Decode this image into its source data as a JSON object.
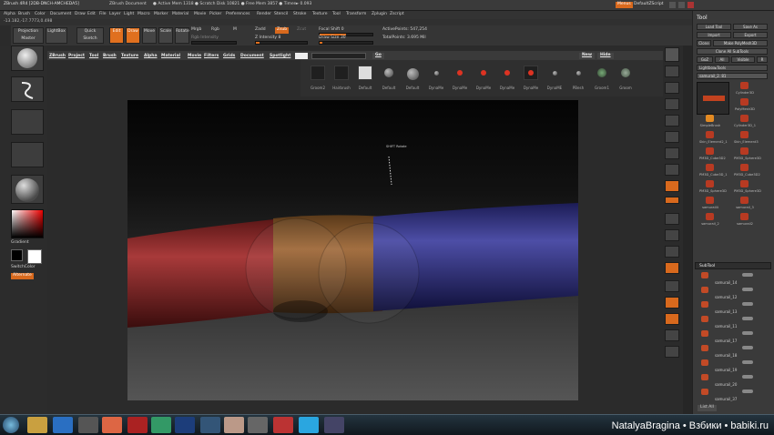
{
  "titlebar": {
    "title": "ZBrush 4R4 [2DB-DNCH-AMCHEDA5]",
    "document": "ZBrush Document",
    "mem": "● Active Mem 1318 ● Scratch Disk 10821 ● Free Mem 3857 ● Timer► 0.093",
    "menus_btn": "Menus",
    "script_btn": "DefaultZScript"
  },
  "menubar": [
    "Alpha",
    "Brush",
    "Color",
    "Document",
    "Draw",
    "Edit",
    "File",
    "Layer",
    "Light",
    "Macro",
    "Marker",
    "Material",
    "Movie",
    "Picker",
    "Preferences",
    "Render",
    "Stencil",
    "Stroke",
    "Texture",
    "Tool",
    "Transform",
    "Zplugin",
    "Zscript"
  ],
  "infobar": {
    "coords": "-13.182,-17.7773,0.498"
  },
  "toptools": {
    "projection_master": "Projection Master",
    "lightbox": "LightBox",
    "quick_sketch": "Quick Sketch",
    "edit": "Edit",
    "draw": "Draw",
    "move": "Move",
    "scale": "Scale",
    "rotate": "Rotate",
    "mrgb": "Mrgb",
    "rgb": "Rgb",
    "m": "M",
    "rgb_intensity": "Rgb Intensity",
    "zadd": "Zadd",
    "zsub": "Zsub",
    "zcut": "Zcut",
    "z_intensity": "Z Intensity 8",
    "focal_shift": "Focal Shift 0",
    "draw_size": "Draw Size 30",
    "active_points": "ActivePoints: 547,254",
    "total_points": "TotalPoints: 3.695 Mil"
  },
  "secmenu": [
    "ZBrush",
    "Project",
    "Tool",
    "Brush",
    "Texture",
    "Alpha",
    "Material",
    "Movie",
    "Filters",
    "Grids",
    "Document",
    "Spotlight"
  ],
  "shelf": {
    "go": "Go",
    "new": "New",
    "hide": "Hide",
    "brushes": [
      "Groom2",
      "Hairbrush",
      "Default",
      "Default",
      "Default",
      "DynaMe",
      "DynaMe",
      "DynaMe",
      "DynaMe",
      "DynaMe",
      "DynaME",
      "PBesh",
      "Groom1",
      "Groom"
    ]
  },
  "leftpanel": {
    "gradient": "Gradient",
    "switch_color": "SwitchColor",
    "alternate": "Alternate"
  },
  "canvas": {
    "pointer_label": "SHIFT Rotate"
  },
  "rightstrip": [
    "Bpr",
    "SPix",
    "Scroll",
    "Zoom",
    "Actual",
    "AAHalf",
    "Persp",
    "Floor",
    "Local",
    "LSym",
    "Frame",
    "Move",
    "Scale",
    "Rotate",
    "PolyF",
    "Transp",
    "Ghost",
    "Solo",
    "Xpose"
  ],
  "rightpanel": {
    "title": "Tool",
    "load_tool": "Load Tool",
    "save_as": "Save As",
    "import": "Import",
    "export": "Export",
    "clone": "Clone",
    "make_polymesh": "Make PolyMesh3D",
    "clone_all": "Clone All SubTools",
    "goz": "GoZ",
    "all": "All",
    "visible": "Visible",
    "r": "R",
    "lightbox_tools": "Lightbox▸Tools",
    "current_tool": "samurail_2. 81",
    "tools": [
      "Cylinder3D",
      "PolyMesh3D",
      "SimpleBrush",
      "Cylinder3D_1",
      "Skin_Element2_1",
      "Skin_Element3",
      "PM3D_Cube3D2",
      "PM3D_Sphere3D",
      "PM3D_Cube3D_1",
      "PM3D_Cube3D2",
      "PM3D_Sphere3D",
      "PM3D_Sphere3D",
      "samurail4",
      "samurail_3",
      "samurail_2",
      "samurail2"
    ],
    "subtool_header": "SubTool",
    "subtools": [
      "samurail_14",
      "samurail_12",
      "samurail_13",
      "samurail_11",
      "samurail_17",
      "samurail_18",
      "samurail_19",
      "samurail_20",
      "samurail_37",
      "samurail_27"
    ],
    "list_all": "List All"
  },
  "taskbar": {
    "watermark": "NatalyaBragina • Взбики • babiki.ru"
  }
}
